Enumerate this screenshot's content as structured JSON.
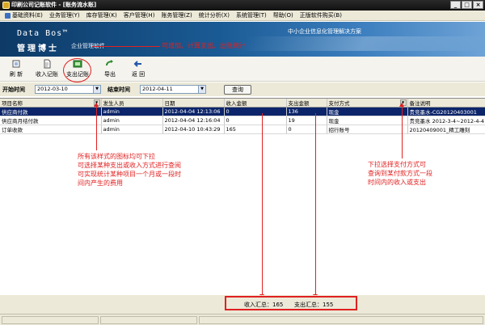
{
  "window": {
    "title": "印刷公司记账软件 - [账务流水账]",
    "buttons": [
      "_",
      "□",
      "×"
    ]
  },
  "menu": [
    "基础资料(E)",
    "业务管理(Y)",
    "库存管理(K)",
    "客户管理(H)",
    "账务管理(Z)",
    "统计分析(X)",
    "系统管理(T)",
    "帮助(O)",
    "正版软件购买(B)"
  ],
  "banner": {
    "brand_en": "Data Bos™",
    "brand_cn": "管理博士",
    "brand_sub": "企业管理软件",
    "slogan": "中小企业信息化管理解决方案",
    "annotation": "可增加、计算支出、出账统计"
  },
  "toolbar": {
    "refresh": "刷 新",
    "income": "收入记账",
    "expense": "支出记账",
    "export": "导出",
    "back": "返 回"
  },
  "filter": {
    "start_label": "开始时间",
    "start_value": "2012-03-10",
    "end_label": "结束时间",
    "end_value": "2012-04-11",
    "query": "查询"
  },
  "table": {
    "columns": [
      "项目名称",
      "发生人员",
      "日期",
      "收入金额",
      "支出金额",
      "支付方式",
      "备注说明"
    ],
    "rows": [
      [
        "供应商付款",
        "admin",
        "2012-04-04 12:13:06",
        "0",
        "136",
        "现金",
        "贵竞墨水-CG20120403001"
      ],
      [
        "供应商月结付款",
        "admin",
        "2012-04-04 12:16:04",
        "0",
        "19",
        "现金",
        "贵竞墨水 2012-3-4~2012-4-4"
      ],
      [
        "订单收款",
        "admin",
        "2012-04-10 10:43:29",
        "165",
        "0",
        "招行账号",
        "20120409001_精工雕刻"
      ]
    ]
  },
  "annotations": {
    "left": [
      "所有该样式的图标均可下拉",
      "可选择某种支出或收入方式进行查阅",
      "可实现统计某种项目一个月或一段时",
      "间内产生的费用"
    ],
    "right": [
      "下拉选择支付方式可",
      "查询到某付款方式一段",
      "时间内的收入或支出"
    ]
  },
  "summary": {
    "income": "收入汇总：165",
    "expense": "支出汇总：155"
  }
}
